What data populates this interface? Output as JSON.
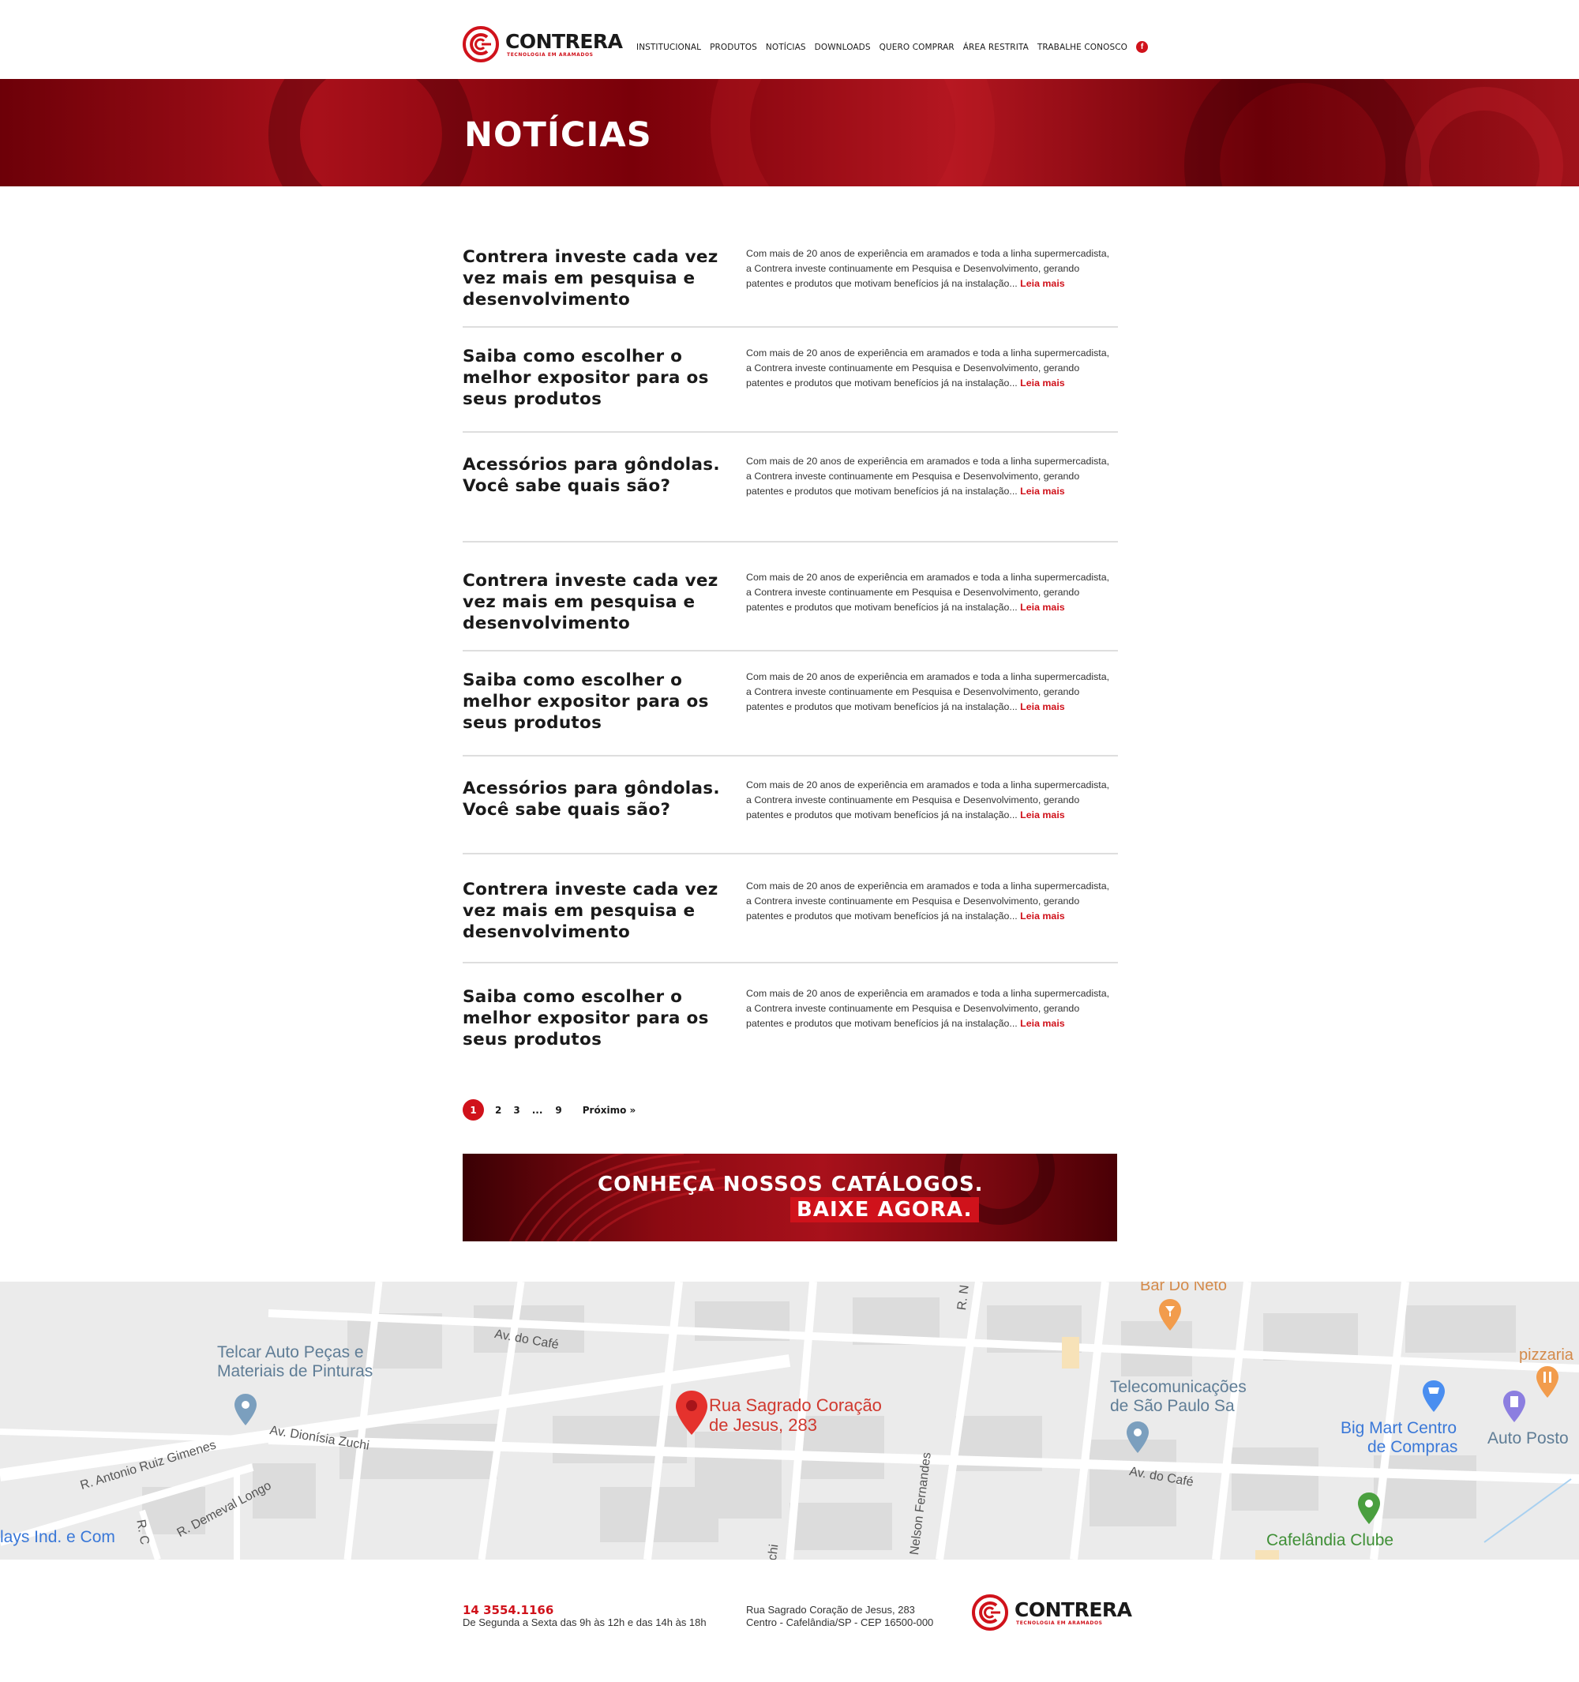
{
  "header": {
    "logo": {
      "brand": "CONTRERA",
      "tagline": "TECNOLOGIA EM ARAMADOS"
    },
    "nav": [
      "INSTITUCIONAL",
      "PRODUTOS",
      "NOTÍCIAS",
      "DOWNLOADS",
      "QUERO COMPRAR",
      "ÁREA RESTRITA",
      "TRABALHE CONOSCO"
    ],
    "social_icon": "facebook-icon"
  },
  "hero": {
    "title": "NOTÍCIAS"
  },
  "news": [
    {
      "title": "Contrera investe cada vez vez mais em pesquisa e desenvolvimento",
      "excerpt": "Com mais de 20 anos de experiência em aramados e toda a linha supermercadista, a Contrera investe continuamente em Pesquisa e Desenvolvimento, gerando patentes e produtos que motivam benefícios já na instalação...",
      "more": "Leia mais"
    },
    {
      "title": "Saiba como escolher o melhor expositor para os seus produtos",
      "excerpt": "Com mais de 20 anos de experiência em aramados e toda a linha supermercadista, a Contrera investe continuamente em Pesquisa e Desenvolvimento, gerando patentes e produtos que motivam benefícios já na instalação...",
      "more": "Leia mais"
    },
    {
      "title": "Acessórios para gôndolas. Você sabe quais são?",
      "excerpt": "Com mais de 20 anos de experiência em aramados e toda a linha supermercadista, a Contrera investe continuamente em Pesquisa e Desenvolvimento, gerando patentes e produtos que motivam benefícios já na instalação...",
      "more": "Leia mais"
    },
    {
      "title": "Contrera investe cada vez vez mais em pesquisa e desenvolvimento",
      "excerpt": "Com mais de 20 anos de experiência em aramados e toda a linha supermercadista, a Contrera investe continuamente em Pesquisa e Desenvolvimento, gerando patentes e produtos que motivam benefícios já na instalação...",
      "more": "Leia mais"
    },
    {
      "title": "Saiba como escolher o melhor expositor para os seus produtos",
      "excerpt": "Com mais de 20 anos de experiência em aramados e toda a linha supermercadista, a Contrera investe continuamente em Pesquisa e Desenvolvimento, gerando patentes e produtos que motivam benefícios já na instalação...",
      "more": "Leia mais"
    },
    {
      "title": "Acessórios para gôndolas. Você sabe quais são?",
      "excerpt": "Com mais de 20 anos de experiência em aramados e toda a linha supermercadista, a Contrera investe continuamente em Pesquisa e Desenvolvimento, gerando patentes e produtos que motivam benefícios já na instalação...",
      "more": "Leia mais"
    },
    {
      "title": "Contrera investe cada vez vez mais em pesquisa e desenvolvimento",
      "excerpt": "Com mais de 20 anos de experiência em aramados e toda a linha supermercadista, a Contrera investe continuamente em Pesquisa e Desenvolvimento, gerando patentes e produtos que motivam benefícios já na instalação...",
      "more": "Leia mais"
    },
    {
      "title": "Saiba como escolher o melhor expositor para os seus produtos",
      "excerpt": "Com mais de 20 anos de experiência em aramados e toda a linha supermercadista, a Contrera investe continuamente em Pesquisa e Desenvolvimento, gerando patentes e produtos que motivam benefícios já na instalação...",
      "more": "Leia mais"
    }
  ],
  "pagination": {
    "current": "1",
    "pages": [
      "2",
      "3"
    ],
    "ellipsis": "...",
    "last": "9",
    "next": "Próximo »"
  },
  "banner": {
    "line1": "CONHEÇA NOSSOS CATÁLOGOS.",
    "line2": "BAIXE AGORA."
  },
  "map": {
    "labels": {
      "bar": "Bar Do Neto",
      "telcar1": "Telcar Auto Peças e",
      "telcar2": "Materiais de Pinturas",
      "av_cafe_1": "Av. do Café",
      "av_cafe_2": "Av. do Café",
      "pin1": "Rua Sagrado Coração",
      "pin2": "de Jesus, 283",
      "tele1": "Telecomunicações",
      "tele2": "de São Paulo Sa",
      "pizzaria": "pizzaria",
      "bigmart1": "Big Mart Centro",
      "bigmart2": "de Compras",
      "autoposto": "Auto Posto",
      "dionisia": "Av. Dionísia Zuchi",
      "antonio": "R. Antonio Ruiz Gimenes",
      "demeval": "R. Demeval Longo",
      "rc": "R. C",
      "nelson": "Nelson Fernandes",
      "rn": "R. N",
      "chi": "chi",
      "lays": "lays Ind. e Com",
      "clube": "Cafelândia Clube"
    },
    "colors": {
      "pin": "#e5322d",
      "poi": "#7b9fbe",
      "green": "#4a9f3f",
      "orange": "#f29c4c",
      "blue": "#4a8ef0",
      "purple": "#8c7ee0"
    }
  },
  "footer": {
    "phone": "14 3554.1166",
    "hours": "De Segunda a Sexta das 9h às 12h e das 14h às 18h",
    "address1": "Rua Sagrado Coração de Jesus, 283",
    "address2": "Centro - Cafelândia/SP - CEP 16500-000",
    "logo": {
      "brand": "CONTRERA",
      "tagline": "TECNOLOGIA EM ARAMADOS"
    }
  },
  "colors": {
    "accent": "#d0121b",
    "text": "#1a1a1a",
    "divider": "#dedede"
  }
}
